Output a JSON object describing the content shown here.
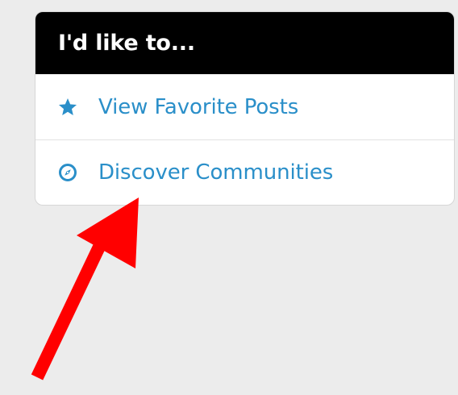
{
  "card": {
    "title": "I'd like to...",
    "items": [
      {
        "label": "View Favorite Posts",
        "icon": "star-icon"
      },
      {
        "label": "Discover Communities",
        "icon": "compass-icon"
      }
    ]
  },
  "colors": {
    "header_bg": "#000000",
    "link": "#2a8fc9",
    "arrow": "#ff0000",
    "page_bg": "#ececec"
  }
}
